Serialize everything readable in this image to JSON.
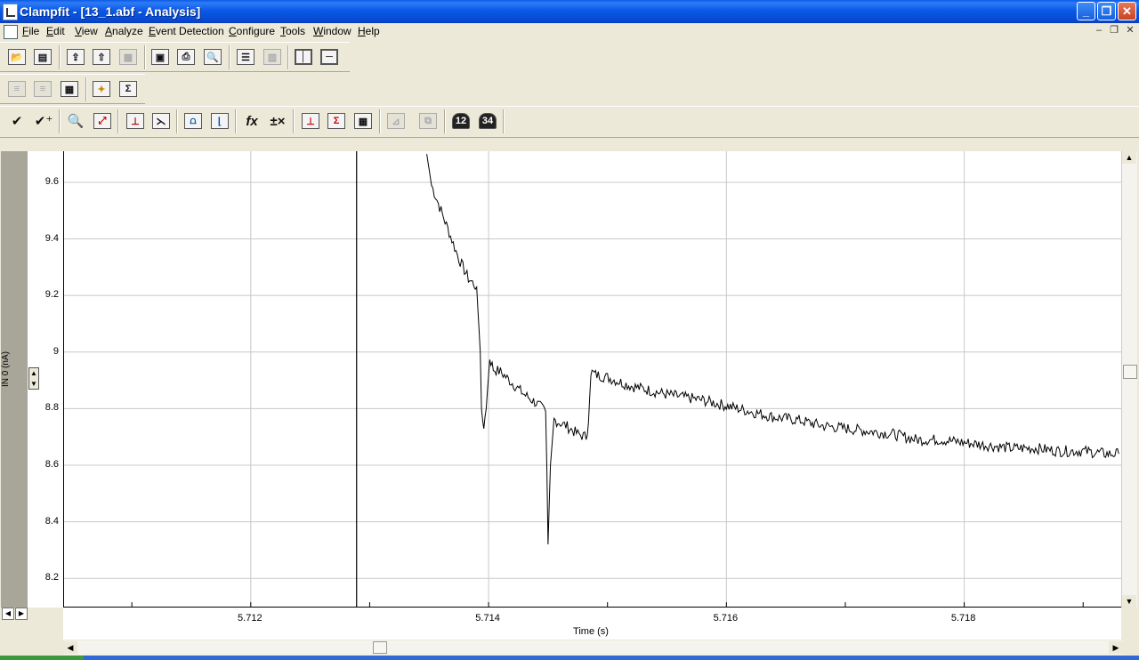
{
  "window": {
    "title": "Clampfit - [13_1.abf - Analysis]",
    "minimize": "_",
    "restore": "❐",
    "close": "✕"
  },
  "menu": {
    "items": [
      "File",
      "Edit",
      "View",
      "Analyze",
      "Event Detection",
      "Configure",
      "Tools",
      "Window",
      "Help"
    ],
    "mdi_minimize": "–",
    "mdi_restore": "❐",
    "mdi_close": "✕"
  },
  "toolbar1": {
    "icons": [
      "open-data-icon",
      "open-analysis-icon",
      "open-other-icon",
      "save-icon",
      "save-as-icon",
      "save-disabled-icon",
      "floppy-icon",
      "print-icon",
      "print-preview-icon",
      "results-icon",
      "lab-book-icon",
      "split-vertical-icon",
      "split-horizontal-icon"
    ]
  },
  "toolbar2": {
    "icons": [
      "prev-sweep-icon",
      "next-sweep-icon",
      "sweep-select-icon",
      "event-icon",
      "statistics-icon"
    ]
  },
  "toolbar3": {
    "icons": [
      "accept-icon",
      "accept-add-icon",
      "zoom-icon",
      "auto-scale-icon",
      "baseline-icon",
      "fit-icon",
      "histogram-icon",
      "decay-icon",
      "function-icon",
      "arithmetic-icon",
      "peak-icon",
      "sum-icon",
      "results-table-icon",
      "disabled-chart-icon",
      "disabled-copy-icon",
      "lock-12-icon",
      "lock-34-icon"
    ],
    "function_glyph": "fx",
    "arithmetic_glyph": "±×"
  },
  "plot": {
    "y_label_line1": "IN 0",
    "y_label_line2": "(nA)",
    "x_label": "Time (s)",
    "cursor_time": 5.71289
  },
  "chart_data": {
    "type": "line",
    "title": "",
    "xlabel": "Time (s)",
    "ylabel": "IN 0 (nA)",
    "xlim": [
      5.71043,
      5.71932
    ],
    "ylim": [
      8.1,
      9.71
    ],
    "x_ticks": [
      "5.712",
      "5.714",
      "5.716",
      "5.718"
    ],
    "x_tick_values": [
      5.712,
      5.714,
      5.716,
      5.718
    ],
    "y_ticks": [
      "8.2",
      "8.4",
      "8.6",
      "8.8",
      "9",
      "9.2",
      "9.4",
      "9.6"
    ],
    "y_tick_values": [
      8.2,
      8.4,
      8.6,
      8.8,
      9.0,
      9.2,
      9.4,
      9.6
    ],
    "grid": true,
    "series": [
      {
        "color": "#000000",
        "x": [
          5.71348,
          5.71352,
          5.7136,
          5.71368,
          5.71375,
          5.71383,
          5.7139,
          5.71393,
          5.71394,
          5.71396,
          5.71398,
          5.71401,
          5.71404,
          5.7141,
          5.7142,
          5.7143,
          5.7144,
          5.71448,
          5.71449,
          5.7145,
          5.71452,
          5.71455,
          5.71465,
          5.71475,
          5.71482,
          5.71484,
          5.71486,
          5.7149,
          5.715,
          5.7152,
          5.7155,
          5.7158,
          5.716,
          5.7162,
          5.7164,
          5.7166,
          5.7168,
          5.717,
          5.7172,
          5.7174,
          5.7176,
          5.7178,
          5.718,
          5.7182,
          5.7184,
          5.7186,
          5.7188,
          5.719,
          5.7192,
          5.7193
        ],
        "values": [
          9.7,
          9.59,
          9.5,
          9.41,
          9.33,
          9.26,
          9.23,
          9.0,
          8.78,
          8.74,
          8.8,
          8.98,
          8.94,
          8.93,
          8.89,
          8.85,
          8.82,
          8.79,
          8.58,
          8.32,
          8.6,
          8.76,
          8.74,
          8.71,
          8.7,
          8.75,
          8.93,
          8.92,
          8.91,
          8.88,
          8.85,
          8.83,
          8.81,
          8.79,
          8.77,
          8.76,
          8.74,
          8.73,
          8.72,
          8.71,
          8.69,
          8.69,
          8.68,
          8.67,
          8.66,
          8.66,
          8.65,
          8.65,
          8.64,
          8.64
        ],
        "noise_amplitude": 0.02
      }
    ]
  }
}
